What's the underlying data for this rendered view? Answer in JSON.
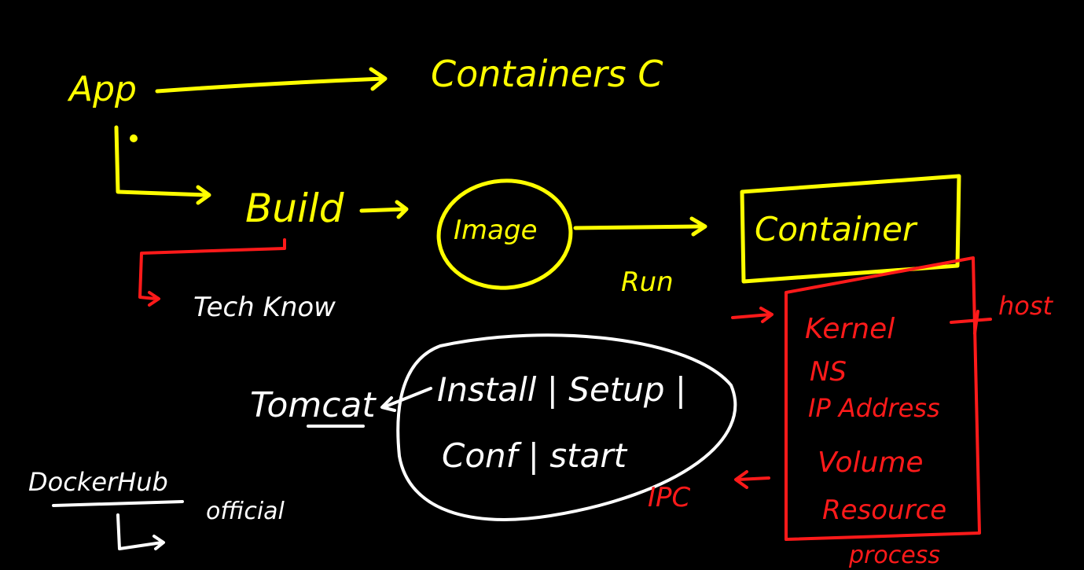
{
  "colors": {
    "background": "#000000",
    "yellow": "#ffff00",
    "white": "#ffffff",
    "red": "#ff1a1a"
  },
  "labels": {
    "app": "App",
    "containers_top": "Containers C",
    "build": "Build",
    "image": "Image",
    "container": "Container",
    "run": "Run",
    "tech_know": "Tech Know",
    "kernel": "Kernel",
    "host": "host",
    "ns": "NS",
    "ip_address": "IP Address",
    "volume": "Volume",
    "resource": "Resource",
    "ipc": "IPC",
    "process": "process",
    "tomcat": "Tomcat",
    "install_setup": "Install | Setup |",
    "conf_start": "Conf | start",
    "dockerhub": "DockerHub",
    "official": "official"
  }
}
